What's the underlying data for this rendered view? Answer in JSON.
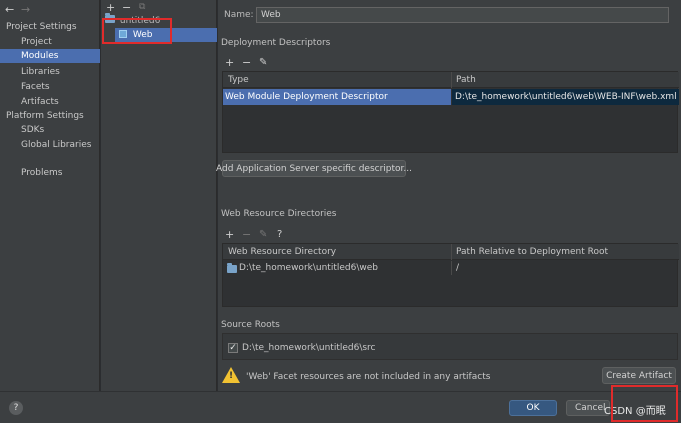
{
  "nav": {
    "back_glyph": "←",
    "forward_glyph": "→",
    "project_settings_header": "Project Settings",
    "project_items": [
      "Project",
      "Modules",
      "Libraries",
      "Facets",
      "Artifacts"
    ],
    "selected_item": "Modules",
    "platform_settings_header": "Platform Settings",
    "platform_items": [
      "SDKs",
      "Global Libraries"
    ],
    "problems": "Problems"
  },
  "tree": {
    "add_glyph": "+",
    "remove_glyph": "−",
    "copy_glyph": "⧉",
    "module_name": "untitled6",
    "facet_name": "Web"
  },
  "form": {
    "name_label": "Name:",
    "name_value": "Web"
  },
  "deployment": {
    "title": "Deployment Descriptors",
    "add_glyph": "+",
    "remove_glyph": "−",
    "edit_glyph": "✎",
    "columns": [
      "Type",
      "Path"
    ],
    "rows": [
      [
        "Web Module Deployment Descriptor",
        "D:\\te_homework\\untitled6\\web\\WEB-INF\\web.xml"
      ]
    ],
    "add_server_button": "Add Application Server specific descriptor..."
  },
  "web_resources": {
    "title": "Web Resource Directories",
    "add_glyph": "+",
    "remove_glyph": "−",
    "edit_glyph": "✎",
    "help_glyph": "?",
    "columns": [
      "Web Resource Directory",
      "Path Relative to Deployment Root"
    ],
    "rows": [
      [
        "D:\\te_homework\\untitled6\\web",
        "/"
      ]
    ]
  },
  "source_roots": {
    "title": "Source Roots",
    "checked_glyph": "✓",
    "path": "D:\\te_homework\\untitled6\\src"
  },
  "warning": {
    "icon": "warning-icon",
    "mark": "!",
    "text": "'Web' Facet resources are not included in any artifacts",
    "create_artifact_button": "Create Artifact"
  },
  "footer": {
    "help_glyph": "?",
    "ok_button": "OK",
    "cancel_button": "Cancel",
    "watermark": "CSDN @而眠"
  },
  "colors": {
    "selection": "#4b6eaf",
    "primary_button": "#365880",
    "highlight_box": "#e02b2b",
    "warning": "#f1c232"
  }
}
